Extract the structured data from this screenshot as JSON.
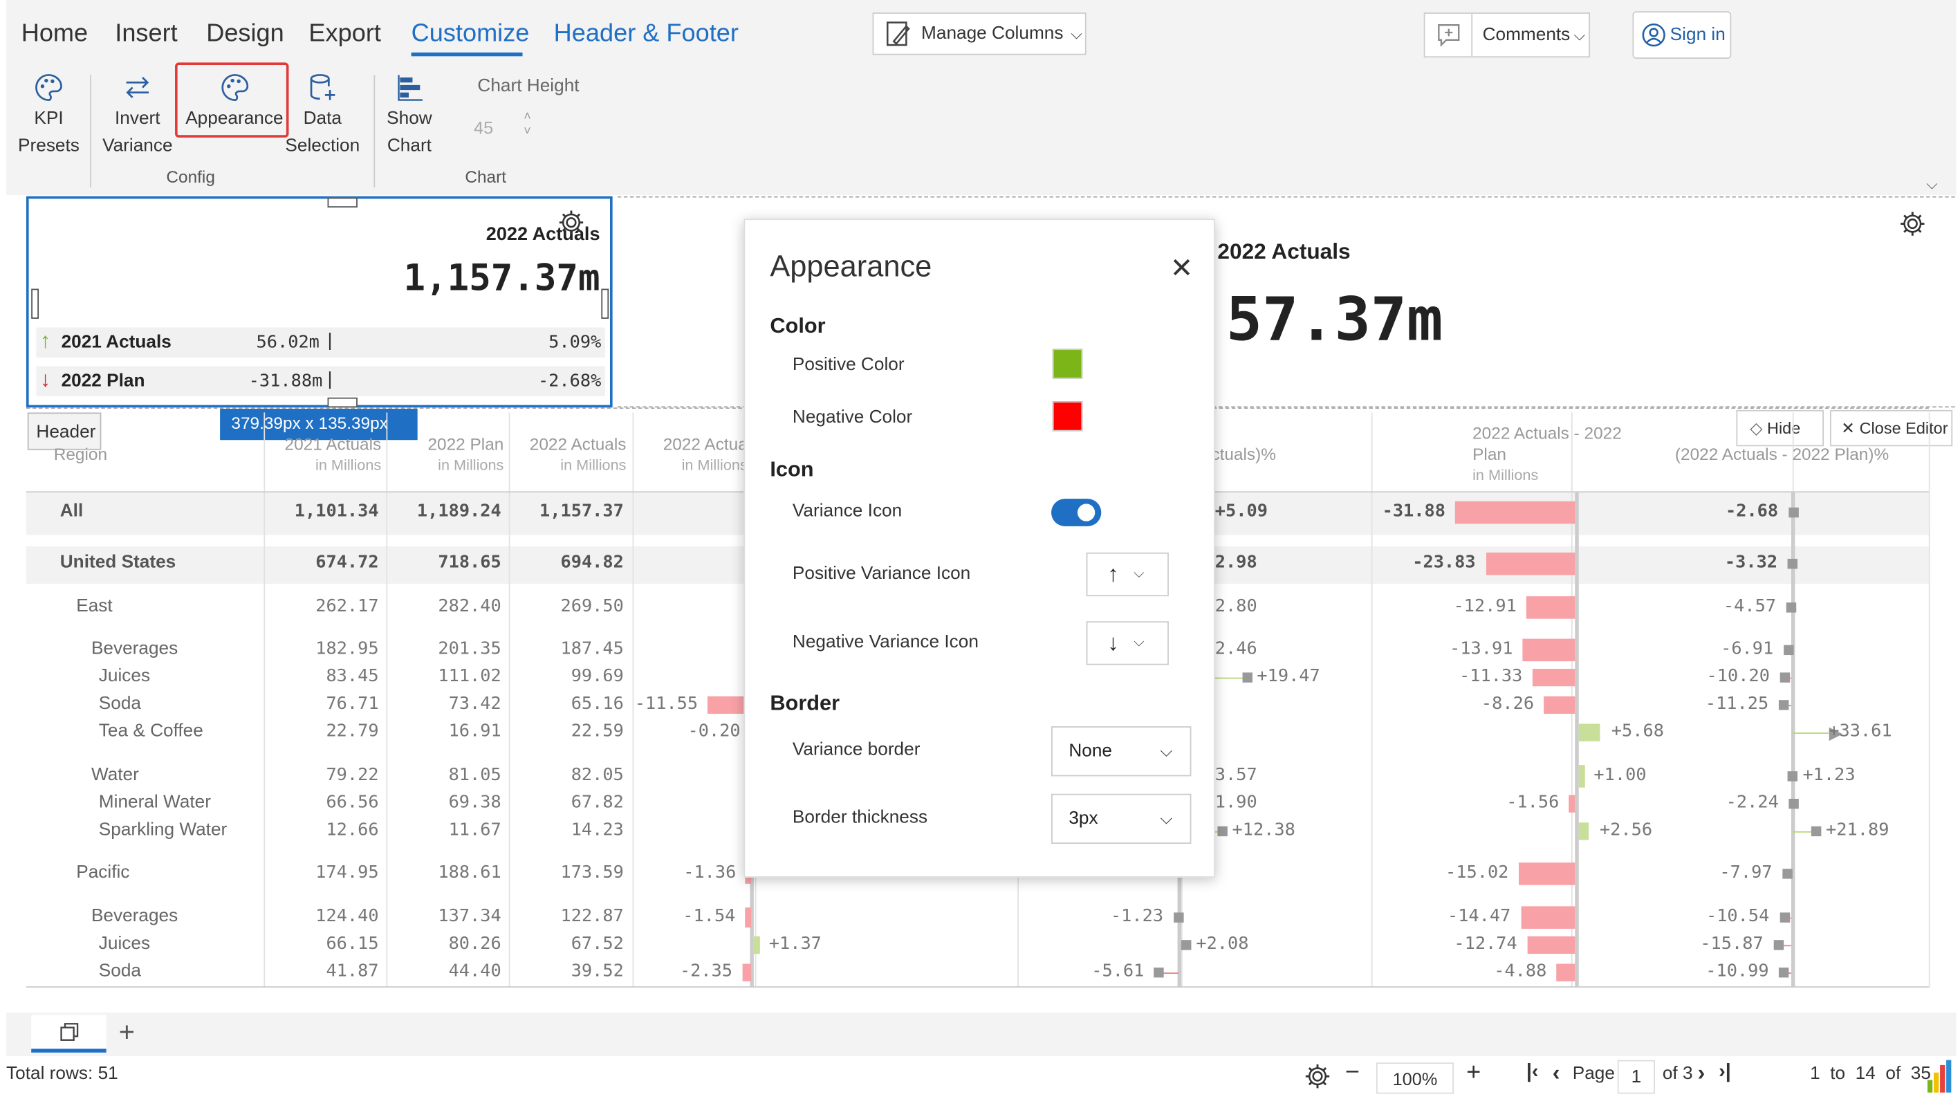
{
  "tabs": [
    "Home",
    "Insert",
    "Design",
    "Export",
    "Customize",
    "Header & Footer"
  ],
  "ribbon": {
    "manage_columns": "Manage Columns",
    "comments": "Comments",
    "sign_in": "Sign in",
    "kpi_presets": [
      "KPI",
      "Presets"
    ],
    "invert_variance": [
      "Invert",
      "Variance"
    ],
    "appearance": "Appearance",
    "data_selection": [
      "Data",
      "Selection"
    ],
    "show_chart": [
      "Show",
      "Chart"
    ],
    "chart_height_label": "Chart Height",
    "chart_height_value": "45",
    "group_config": "Config",
    "group_chart": "Chart"
  },
  "card": {
    "title": "2022 Actuals",
    "value": "1,157.37m",
    "rows": [
      {
        "label": "2021 Actuals",
        "value": "56.02m",
        "pct": "5.09%",
        "dir": "up"
      },
      {
        "label": "2022 Plan",
        "value": "-31.88m",
        "pct": "-2.68%",
        "dir": "down"
      }
    ],
    "size_tooltip": "379.39px x 135.39px",
    "header_tag": "Header"
  },
  "bigcard": {
    "title": "2022 Actuals",
    "value": ".57.37m"
  },
  "editor_buttons": {
    "hide": "Hide",
    "close": "Close Editor"
  },
  "grid": {
    "headers": [
      {
        "title": "Region",
        "sub": ""
      },
      {
        "title": "2021 Actuals",
        "sub": "in Millions"
      },
      {
        "title": "2022 Plan",
        "sub": "in Millions"
      },
      {
        "title": "2022 Actuals",
        "sub": "in Millions"
      },
      {
        "title": "2022 Actua",
        "sub": "in Millions"
      },
      {
        "title": "Actuals)%",
        "sub": ""
      },
      {
        "title": "2022 Actuals - 2022",
        "title2": "Plan",
        "sub": "in Millions"
      },
      {
        "title": "(2022 Actuals - 2022 Plan)%",
        "sub": ""
      }
    ],
    "rows": [
      {
        "label": "All",
        "indent": 0,
        "bold": true,
        "v": [
          "1,101.34",
          "1,189.24",
          "1,157.37"
        ],
        "c4": "",
        "c5": "+5.09",
        "c6": "-31.88",
        "c7": "-2.68"
      },
      {
        "label": "United States",
        "indent": 0,
        "bold": true,
        "v": [
          "674.72",
          "718.65",
          "694.82"
        ],
        "c4": "",
        "c5": "2.98",
        "c6": "-23.83",
        "c7": "-3.32"
      },
      {
        "label": "East",
        "indent": 1,
        "bold": false,
        "v": [
          "262.17",
          "282.40",
          "269.50"
        ],
        "c4": "",
        "c5": "2.80",
        "c6": "-12.91",
        "c7": "-4.57"
      },
      {
        "label": "Beverages",
        "indent": 2,
        "bold": false,
        "v": [
          "182.95",
          "201.35",
          "187.45"
        ],
        "c4": "",
        "c5": "2.46",
        "c6": "-13.91",
        "c7": "-6.91"
      },
      {
        "label": "Juices",
        "indent": 3,
        "bold": false,
        "v": [
          "83.45",
          "111.02",
          "99.69"
        ],
        "c4": "",
        "c5": "+19.47",
        "c6": "-11.33",
        "c7": "-10.20"
      },
      {
        "label": "Soda",
        "indent": 3,
        "bold": false,
        "v": [
          "76.71",
          "73.42",
          "65.16"
        ],
        "c4": "-11.55",
        "c5": "",
        "c6": "-8.26",
        "c7": "-11.25"
      },
      {
        "label": "Tea & Coffee",
        "indent": 3,
        "bold": false,
        "v": [
          "22.79",
          "16.91",
          "22.59"
        ],
        "c4": "-0.20",
        "c5": "",
        "c6": "+5.68",
        "c7": "+33.61"
      },
      {
        "label": "Water",
        "indent": 2,
        "bold": false,
        "v": [
          "79.22",
          "81.05",
          "82.05"
        ],
        "c4": "",
        "c5": "3.57",
        "c6": "+1.00",
        "c7": "+1.23"
      },
      {
        "label": "Mineral Water",
        "indent": 3,
        "bold": false,
        "v": [
          "66.56",
          "69.38",
          "67.82"
        ],
        "c4": "",
        "c5": "1.90",
        "c6": "-1.56",
        "c7": "-2.24"
      },
      {
        "label": "Sparkling Water",
        "indent": 3,
        "bold": false,
        "v": [
          "12.66",
          "11.67",
          "14.23"
        ],
        "c4": "",
        "c5": "+12.38",
        "c6": "+2.56",
        "c7": "+21.89"
      },
      {
        "label": "Pacific",
        "indent": 1,
        "bold": false,
        "v": [
          "174.95",
          "188.61",
          "173.59"
        ],
        "c4": "-1.36",
        "c5": "",
        "c6": "-15.02",
        "c7": "-7.97"
      },
      {
        "label": "Beverages",
        "indent": 2,
        "bold": false,
        "v": [
          "124.40",
          "137.34",
          "122.87"
        ],
        "c4": "-1.54",
        "c5": "-1.23",
        "c6": "-14.47",
        "c7": "-10.54"
      },
      {
        "label": "Juices",
        "indent": 3,
        "bold": false,
        "v": [
          "66.15",
          "80.26",
          "67.52"
        ],
        "c4": "+1.37",
        "c5": "+2.08",
        "c6": "-12.74",
        "c7": "-15.87"
      },
      {
        "label": "Soda",
        "indent": 3,
        "bold": false,
        "v": [
          "41.87",
          "44.40",
          "39.52"
        ],
        "c4": "-2.35",
        "c5": "-5.61",
        "c6": "-4.88",
        "c7": "-10.99"
      }
    ]
  },
  "panel": {
    "title": "Appearance",
    "color_heading": "Color",
    "positive_color_label": "Positive Color",
    "positive_color": "#7cb518",
    "negative_color_label": "Negative Color",
    "negative_color": "#ff0000",
    "icon_heading": "Icon",
    "variance_icon_label": "Variance Icon",
    "variance_icon_on": true,
    "positive_variance_icon_label": "Positive Variance Icon",
    "negative_variance_icon_label": "Negative Variance Icon",
    "border_heading": "Border",
    "variance_border_label": "Variance border",
    "variance_border_value": "None",
    "border_thickness_label": "Border thickness",
    "border_thickness_value": "3px"
  },
  "status": {
    "total_rows": "Total rows: 51",
    "zoom": "100%",
    "page_label": "Page",
    "page_value": "1",
    "page_of": "of 3",
    "range": "1  to  14  of  35"
  }
}
